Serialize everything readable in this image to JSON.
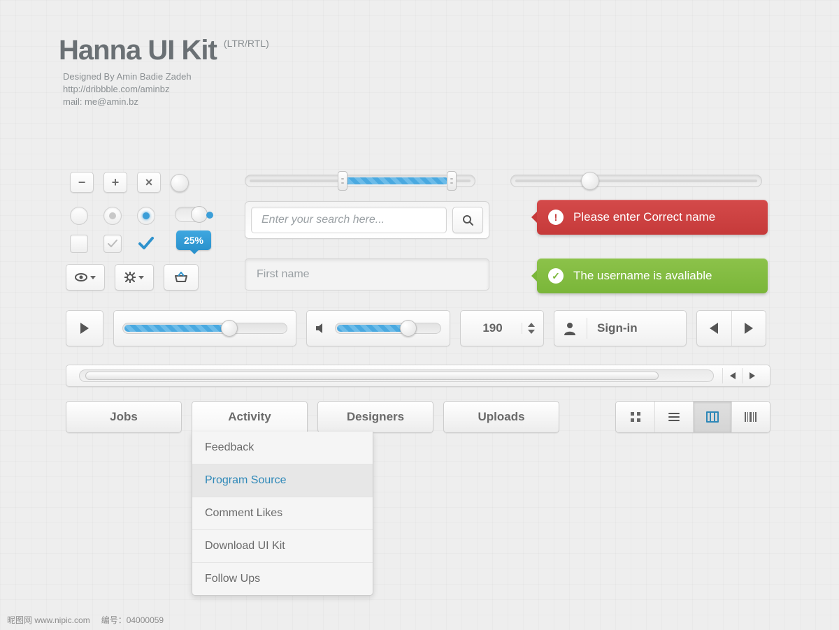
{
  "header": {
    "title": "Hanna UI Kit",
    "suffix": "(LTR/RTL)",
    "designed_by": "Designed By Amin Badie Zadeh",
    "url": "http://dribbble.com/aminbz",
    "mail": "mail: me@amin.bz"
  },
  "icon_buttons": {
    "minus": "−",
    "plus": "+",
    "close": "×"
  },
  "badge_value": "25%",
  "search": {
    "placeholder": "Enter your search here..."
  },
  "firstname_placeholder": "First name",
  "alert_error": "Please enter Correct name",
  "alert_success": "The username is avaliable",
  "stepper_value": "190",
  "signin_label": "Sign-in",
  "tabs": [
    "Jobs",
    "Activity",
    "Designers",
    "Uploads"
  ],
  "dropdown_items": [
    "Feedback",
    "Program Source",
    "Comment Likes",
    "Download UI Kit",
    "Follow Ups"
  ],
  "footer": {
    "a": "昵图网 www.nipic.com",
    "b": "编号：04000059"
  }
}
